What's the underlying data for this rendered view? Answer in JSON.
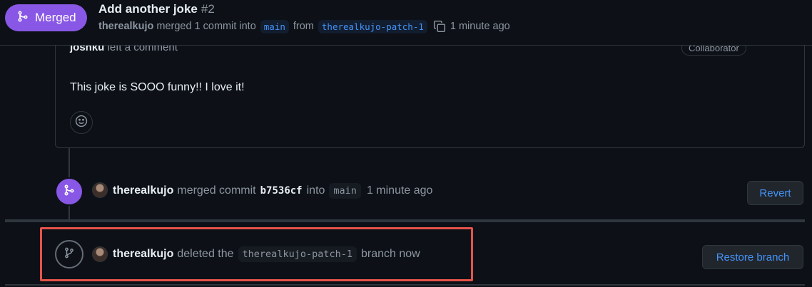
{
  "header": {
    "status_badge": "Merged",
    "title": "Add another joke",
    "number": "#2",
    "author": "therealkujo",
    "merge_text": "merged 1 commit into",
    "base_branch": "main",
    "from_text": "from",
    "head_branch": "therealkujo-patch-1",
    "time": "1 minute ago"
  },
  "comment": {
    "author": "joshku",
    "action": "left a comment",
    "role_badge": "Collaborator",
    "menu": "···",
    "body": "This joke is SOOO funny!! I love it!"
  },
  "events": {
    "merge": {
      "actor": "therealkujo",
      "verb": "merged commit",
      "sha": "b7536cf",
      "into": "into",
      "branch": "main",
      "time": "1 minute ago",
      "button": "Revert"
    },
    "delete": {
      "actor": "therealkujo",
      "verb": "deleted the",
      "branch": "therealkujo-patch-1",
      "suffix": "branch now",
      "button": "Restore branch"
    }
  },
  "colors": {
    "merged_purple": "#8957e5",
    "link_blue": "#4493f8",
    "highlight_red": "#e5534b",
    "background": "#0d1117"
  },
  "icons": [
    "git-merge-icon",
    "copy-icon",
    "smiley-icon",
    "git-branch-icon",
    "kebab-horizontal-icon"
  ]
}
